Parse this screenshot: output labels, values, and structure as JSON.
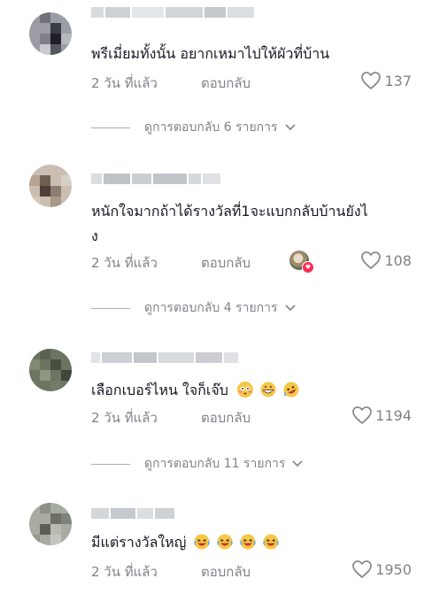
{
  "comments": [
    {
      "text": "พรีเมี่ยมทั้งนั้น อยากเหมาไปให้ผัวที่บ้าน",
      "time": "2 วัน ที่แล้ว",
      "reply_label": "ตอบกลับ",
      "likes": "137",
      "view_replies": "ดูการตอบกลับ 6 รายการ"
    },
    {
      "text_line1": "หนักใจมากถ้าได้รางวัลที่1จะแบกกลับบ้านยังไ",
      "text_line2": "ง",
      "time": "2 วัน ที่แล้ว",
      "reply_label": "ตอบกลับ",
      "likes": "108",
      "view_replies": "ดูการตอบกลับ 4 รายการ"
    },
    {
      "text": "เลือกเบอร์ไหน ใจก็เจ๊บ",
      "emojis": [
        "flushed-face",
        "grinning-face",
        "rofl-face"
      ],
      "time": "2 วัน ที่แล้ว",
      "reply_label": "ตอบกลับ",
      "likes": "1194",
      "view_replies": "ดูการตอบกลับ 11 รายการ"
    },
    {
      "text": "มีแต่รางวัลใหญ่",
      "emojis": [
        "laughing-face",
        "laughing-face",
        "laughing-face",
        "laughing-face"
      ],
      "time": "2 วัน ที่แล้ว",
      "reply_label": "ตอบกลับ",
      "likes": "1950"
    }
  ],
  "icons": {
    "like": "heart-outline-icon",
    "expand": "chevron-down-icon",
    "creator_liked": "heart-badge-icon"
  },
  "colors": {
    "text": "#161823",
    "muted": "#8a8b91",
    "accent": "#fe2c55"
  }
}
